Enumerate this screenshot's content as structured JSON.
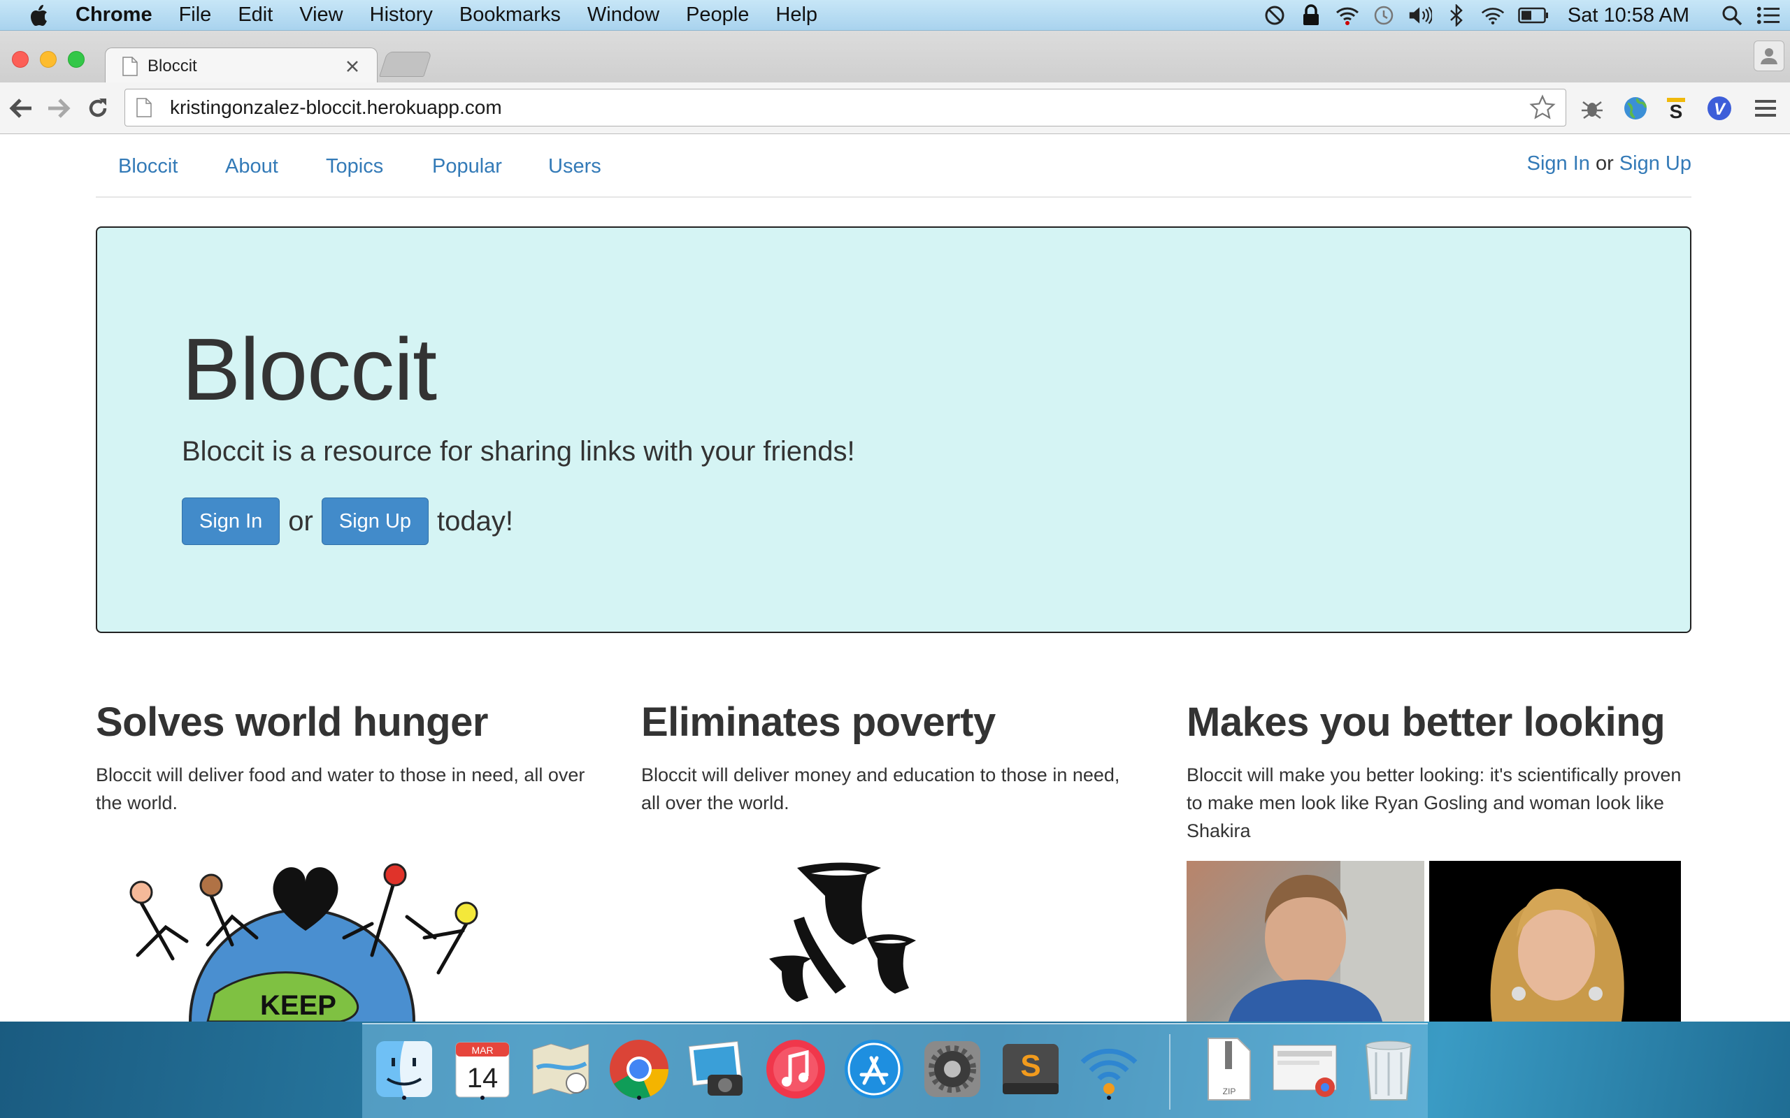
{
  "menubar": {
    "app_name": "Chrome",
    "items": [
      "File",
      "Edit",
      "View",
      "History",
      "Bookmarks",
      "Window",
      "People",
      "Help"
    ],
    "clock": "Sat 10:58 AM"
  },
  "browser": {
    "tab_title": "Bloccit",
    "url": "kristingonzalez-bloccit.herokuapp.com"
  },
  "site": {
    "nav": [
      "Bloccit",
      "About",
      "Topics",
      "Popular",
      "Users"
    ],
    "auth": {
      "sign_in": "Sign In",
      "or": "or",
      "sign_up": "Sign Up"
    },
    "jumbotron": {
      "title": "Bloccit",
      "lead": "Bloccit is a resource for sharing links with your friends!",
      "sign_in_button": "Sign In",
      "or": "or",
      "sign_up_button": "Sign Up",
      "today": "today!"
    },
    "features": [
      {
        "title": "Solves world hunger",
        "text": "Bloccit will deliver food and water to those in need, all over the world."
      },
      {
        "title": "Eliminates poverty",
        "text": "Bloccit will deliver money and education to those in need, all over the world."
      },
      {
        "title": "Makes you better looking",
        "text": "Bloccit will make you better looking: it's scientifically proven to make men look like Ryan Gosling and woman look like Shakira"
      }
    ],
    "illustration_text": "KEEP"
  },
  "dock": {
    "calendar_month": "MAR",
    "calendar_day": "14",
    "zip_label": "ZIP"
  },
  "colors": {
    "link": "#337ab7",
    "jumbotron_bg": "#d5f4f4",
    "button": "#428bca"
  }
}
